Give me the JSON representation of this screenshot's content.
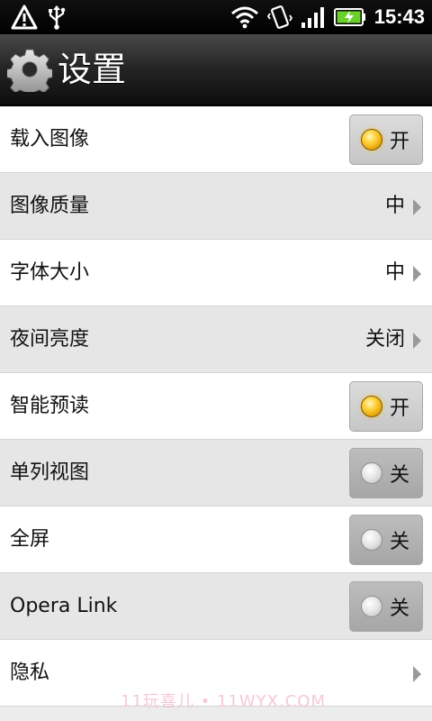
{
  "status_bar": {
    "time": "15:43",
    "left_icons": [
      "warning-icon",
      "usb-icon"
    ],
    "right_icons": [
      "wifi-icon",
      "vibrate-icon",
      "signal-icon",
      "battery-charging-icon"
    ]
  },
  "header": {
    "title": "设置",
    "icon": "gear-icon"
  },
  "settings": [
    {
      "label": "载入图像",
      "type": "toggle",
      "state": "开",
      "on": true
    },
    {
      "label": "图像质量",
      "type": "select",
      "value": "中"
    },
    {
      "label": "字体大小",
      "type": "select",
      "value": "中"
    },
    {
      "label": "夜间亮度",
      "type": "select",
      "value": "关闭"
    },
    {
      "label": "智能预读",
      "type": "toggle",
      "state": "开",
      "on": true
    },
    {
      "label": "单列视图",
      "type": "toggle",
      "state": "关",
      "on": false
    },
    {
      "label": "全屏",
      "type": "toggle",
      "state": "关",
      "on": false
    },
    {
      "label": "Opera Link",
      "type": "toggle",
      "state": "关",
      "on": false
    },
    {
      "label": "隐私",
      "type": "nav"
    }
  ],
  "watermark": "11玩喜儿 • 11WYX.COM",
  "colors": {
    "row_white": "#ffffff",
    "row_gray": "#e6e6e6",
    "toggle_on_knob": "#ffc21a",
    "chevron": "#999999"
  }
}
